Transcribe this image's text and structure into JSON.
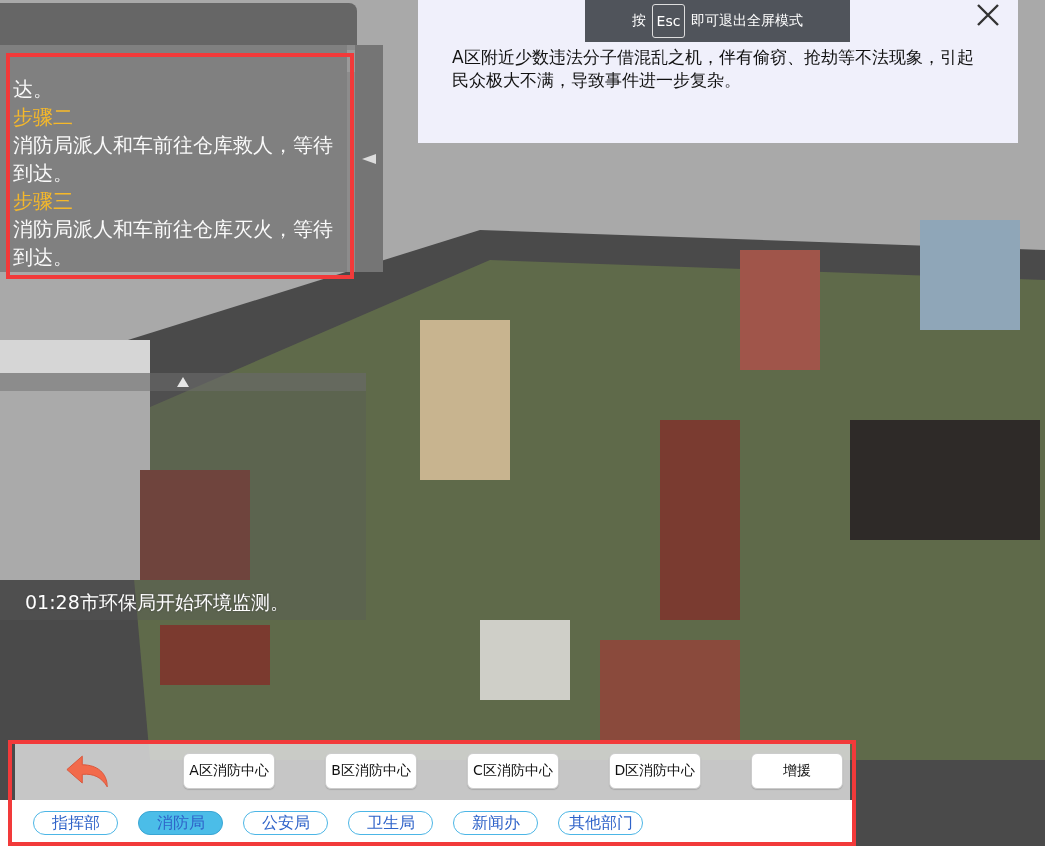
{
  "steps_panel": {
    "lines": [
      {
        "kind": "text",
        "text": "达。"
      },
      {
        "kind": "heading",
        "text": "步骤二"
      },
      {
        "kind": "text",
        "text": "消防局派人和车前往仓库救人，等待到达。"
      },
      {
        "kind": "heading",
        "text": "步骤三"
      },
      {
        "kind": "text",
        "text": "消防局派人和车前往仓库灭火，等待到达。"
      }
    ]
  },
  "log_panel": {
    "entry": "01:28市环保局开始环境监测。"
  },
  "notice": {
    "text": "A区附近少数违法分子借混乱之机，伴有偷窃、抢劫等不法现象，引起民众极大不满，导致事件进一步复杂。"
  },
  "fullscreen_hint": {
    "before": "按",
    "key": "Esc",
    "after": "即可退出全屏模式"
  },
  "actions": [
    {
      "label": "A区消防中心"
    },
    {
      "label": "B区消防中心"
    },
    {
      "label": "C区消防中心"
    },
    {
      "label": "D区消防中心"
    },
    {
      "label": "增援"
    }
  ],
  "departments": [
    {
      "label": "指挥部",
      "selected": false
    },
    {
      "label": "消防局",
      "selected": true
    },
    {
      "label": "公安局",
      "selected": false
    },
    {
      "label": "卫生局",
      "selected": false
    },
    {
      "label": "新闻办",
      "selected": false
    },
    {
      "label": "其他部门",
      "selected": false
    }
  ]
}
